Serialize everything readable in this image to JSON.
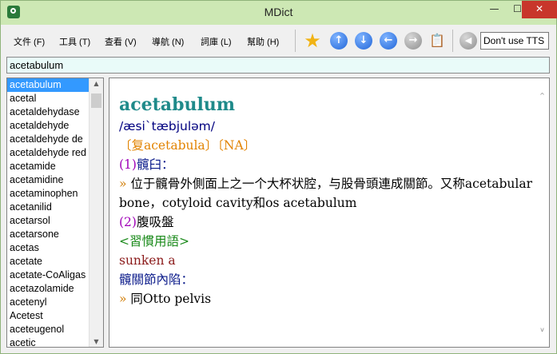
{
  "window": {
    "title": "MDict"
  },
  "titlebar": {
    "minimize": "—",
    "maximize": "☐",
    "close": "✕"
  },
  "menu": {
    "file": "文件 (F)",
    "tools": "工具 (T)",
    "view": "查看 (V)",
    "navigate": "導航 (N)",
    "library": "詞庫 (L)",
    "help": "幫助 (H)"
  },
  "toolbar": {
    "icons": [
      "star-icon",
      "up-arrow-icon",
      "down-arrow-icon",
      "back-icon",
      "forward-icon",
      "clipboard-icon",
      "speaker-icon"
    ],
    "tts_value": "Don't use TTS"
  },
  "search": {
    "value": "acetabulum"
  },
  "wordlist": {
    "items": [
      "acetabulum",
      "acetal",
      "acetaldehydase",
      "acetaldehyde",
      "acetaldehyde de",
      "acetaldehyde red",
      "acetamide",
      "acetamidine",
      "acetaminophen",
      "acetanilid",
      "acetarsol",
      "acetarsone",
      "acetas",
      "acetate",
      "acetate-CoAligas",
      "acetazolamide",
      "acetenyl",
      "Acetest",
      "aceteugenol",
      "acetic"
    ],
    "selected_index": 0
  },
  "entry": {
    "headword": "acetabulum",
    "phonetic": "/æsi`tæbjuləm/",
    "plural_note": "〔复acetabula〕〔NA〕",
    "sense1_num": "(1)",
    "sense1_head": "髖臼：",
    "sense1_bullet": "»",
    "sense1_def": "位于髖骨外側面上之一个大杯状腔，与股骨頭連成關節。又称acetabular bone，cotyloid cavity和os acetabulum",
    "sense2_num": "(2)",
    "sense2_head": "腹吸盤",
    "usage_label": "<習慣用語>",
    "phrase": "sunken a",
    "phrase_gloss": "髖關節內陷：",
    "phrase_bullet": "»",
    "phrase_def": "同Otto pelvis"
  }
}
